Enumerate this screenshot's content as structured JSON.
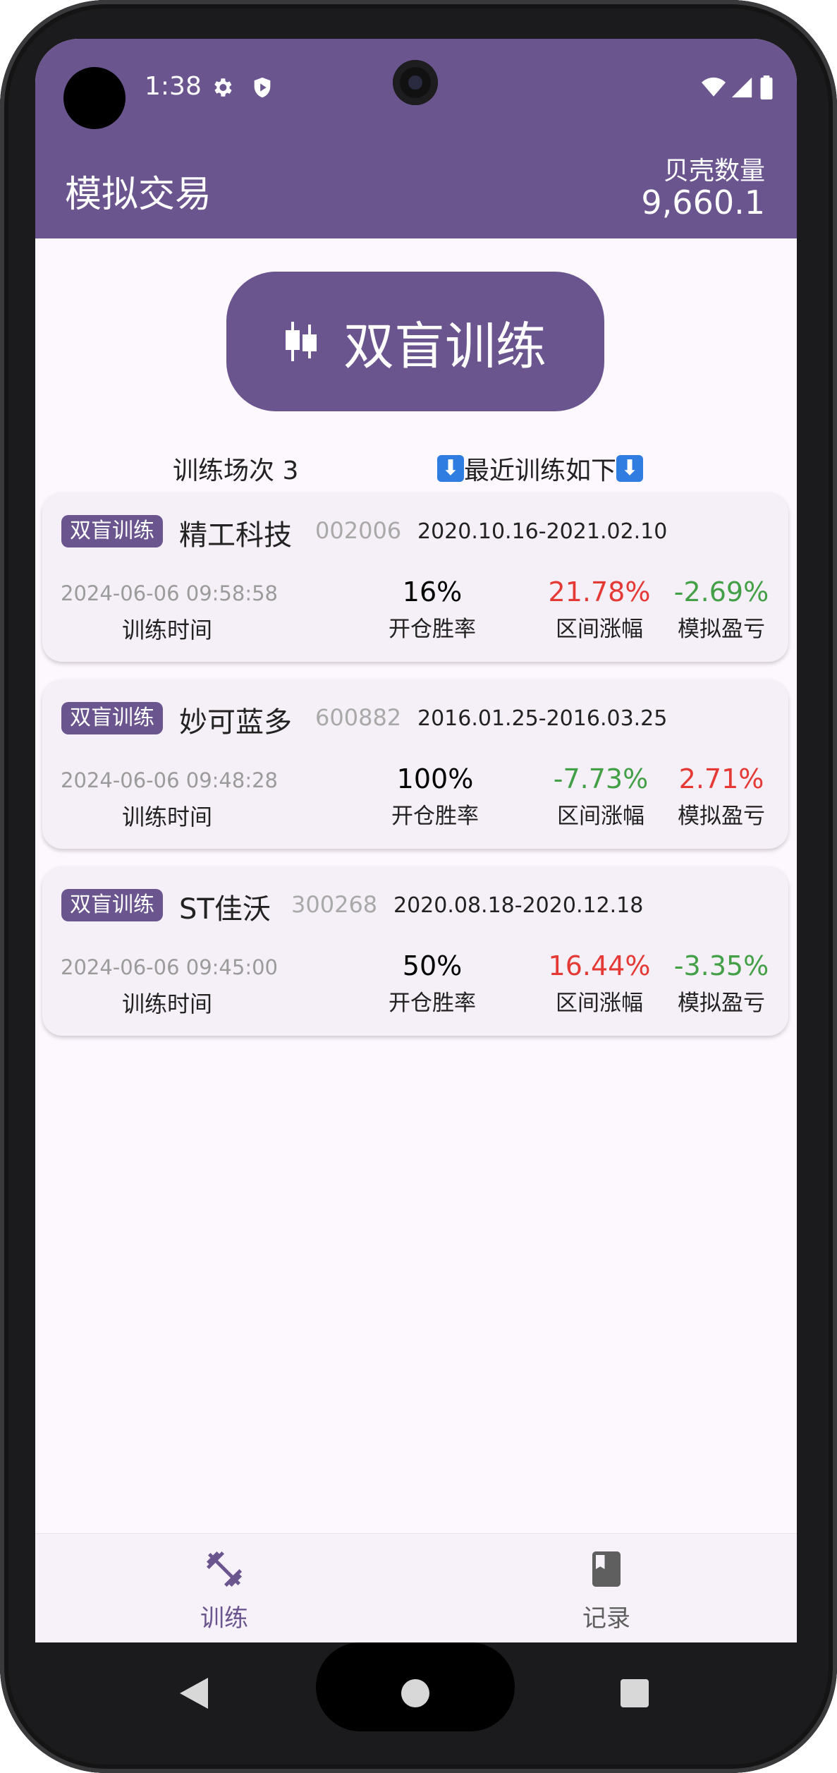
{
  "status_bar": {
    "time": "1:38"
  },
  "app_bar": {
    "title": "模拟交易",
    "shell_label": "贝壳数量",
    "shell_value": "9,660.1"
  },
  "main_button": {
    "label": "双盲训练"
  },
  "summary": {
    "sessions_text": "训练场次 3",
    "recent_text": "最近训练如下",
    "arrow": "⬇"
  },
  "cards": [
    {
      "badge": "双盲训练",
      "name": "精工科技",
      "code": "002006",
      "range": "2020.10.16-2021.02.10",
      "timestamp": "2024-06-06 09:58:58",
      "time_label": "训练时间",
      "win_rate": "16%",
      "win_rate_label": "开仓胜率",
      "interval": "21.78%",
      "interval_label": "区间涨幅",
      "interval_color": "#e53935",
      "pnl": "-2.69%",
      "pnl_label": "模拟盈亏",
      "pnl_color": "#43a047"
    },
    {
      "badge": "双盲训练",
      "name": "妙可蓝多",
      "code": "600882",
      "range": "2016.01.25-2016.03.25",
      "timestamp": "2024-06-06 09:48:28",
      "time_label": "训练时间",
      "win_rate": "100%",
      "win_rate_label": "开仓胜率",
      "interval": "-7.73%",
      "interval_label": "区间涨幅",
      "interval_color": "#43a047",
      "pnl": "2.71%",
      "pnl_label": "模拟盈亏",
      "pnl_color": "#e53935"
    },
    {
      "badge": "双盲训练",
      "name": "ST佳沃",
      "code": "300268",
      "range": "2020.08.18-2020.12.18",
      "timestamp": "2024-06-06 09:45:00",
      "time_label": "训练时间",
      "win_rate": "50%",
      "win_rate_label": "开仓胜率",
      "interval": "16.44%",
      "interval_label": "区间涨幅",
      "interval_color": "#e53935",
      "pnl": "-3.35%",
      "pnl_label": "模拟盈亏",
      "pnl_color": "#43a047"
    }
  ],
  "bottom_nav": [
    {
      "label": "训练",
      "icon": "dumbbell-icon",
      "active": true
    },
    {
      "label": "记录",
      "icon": "book-icon",
      "active": false
    }
  ],
  "colors": {
    "primary": "#6a558f",
    "up": "#e53935",
    "down": "#43a047"
  }
}
